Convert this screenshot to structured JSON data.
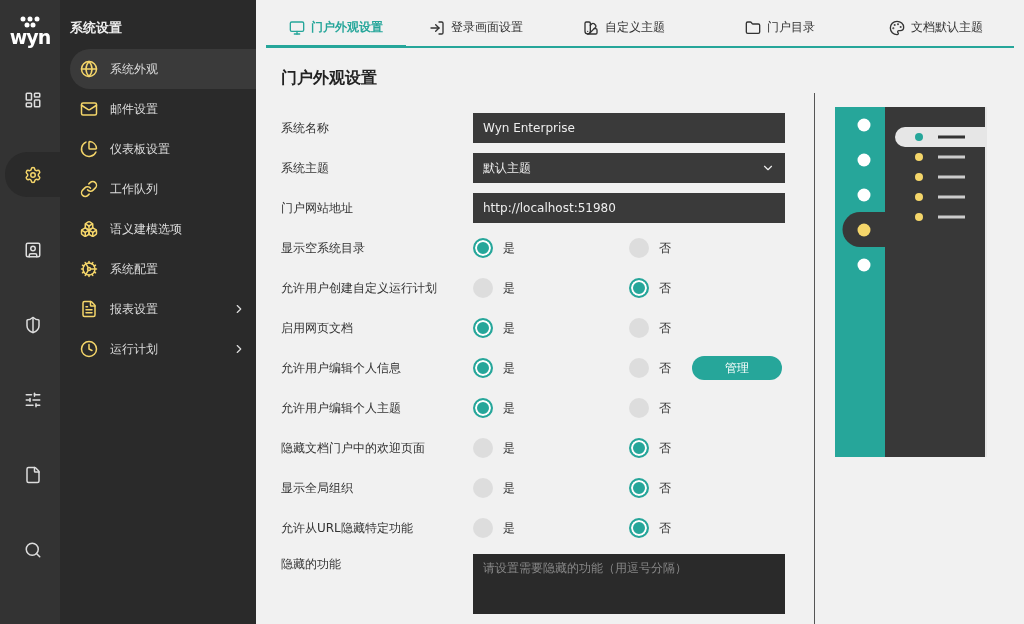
{
  "logo": {
    "text": "wyn"
  },
  "rail": {
    "items": [
      {
        "selected": false
      },
      {
        "selected": true
      },
      {
        "selected": false
      },
      {
        "selected": false
      },
      {
        "selected": false
      },
      {
        "selected": false
      },
      {
        "selected": false
      }
    ]
  },
  "sidebar": {
    "title": "系统设置",
    "items": [
      {
        "label": "系统外观",
        "selected": true,
        "has_children": false
      },
      {
        "label": "邮件设置",
        "selected": false,
        "has_children": false
      },
      {
        "label": "仪表板设置",
        "selected": false,
        "has_children": false
      },
      {
        "label": "工作队列",
        "selected": false,
        "has_children": false
      },
      {
        "label": "语义建模选项",
        "selected": false,
        "has_children": false
      },
      {
        "label": "系统配置",
        "selected": false,
        "has_children": false
      },
      {
        "label": "报表设置",
        "selected": false,
        "has_children": true
      },
      {
        "label": "运行计划",
        "selected": false,
        "has_children": true
      }
    ]
  },
  "tabs": [
    {
      "label": "门户外观设置",
      "selected": true
    },
    {
      "label": "登录画面设置",
      "selected": false
    },
    {
      "label": "自定义主题",
      "selected": false
    },
    {
      "label": "门户目录",
      "selected": false
    },
    {
      "label": "文档默认主题",
      "selected": false
    }
  ],
  "heading": "门户外观设置",
  "form": [
    {
      "kind": "text",
      "label": "系统名称",
      "value": "Wyn Enterprise"
    },
    {
      "kind": "select",
      "label": "系统主题",
      "value": "默认主题"
    },
    {
      "kind": "text",
      "label": "门户网站地址",
      "value": "http://localhost:51980"
    },
    {
      "kind": "radio",
      "label": "显示空系统目录",
      "options": [
        {
          "label": "是",
          "selected": true
        },
        {
          "label": "否",
          "selected": false
        }
      ]
    },
    {
      "kind": "radio",
      "label": "允许用户创建自定义运行计划",
      "options": [
        {
          "label": "是",
          "selected": false
        },
        {
          "label": "否",
          "selected": true
        }
      ]
    },
    {
      "kind": "radio",
      "label": "启用网页文档",
      "options": [
        {
          "label": "是",
          "selected": true
        },
        {
          "label": "否",
          "selected": false
        }
      ]
    },
    {
      "kind": "radio",
      "label": "允许用户编辑个人信息",
      "options": [
        {
          "label": "是",
          "selected": true
        },
        {
          "label": "否",
          "selected": false
        }
      ],
      "button": "管理"
    },
    {
      "kind": "radio",
      "label": "允许用户编辑个人主题",
      "options": [
        {
          "label": "是",
          "selected": true
        },
        {
          "label": "否",
          "selected": false
        }
      ]
    },
    {
      "kind": "radio",
      "label": "隐藏文档门户中的欢迎页面",
      "options": [
        {
          "label": "是",
          "selected": false
        },
        {
          "label": "否",
          "selected": true
        }
      ]
    },
    {
      "kind": "radio",
      "label": "显示全局组织",
      "options": [
        {
          "label": "是",
          "selected": false
        },
        {
          "label": "否",
          "selected": true
        }
      ]
    },
    {
      "kind": "radio",
      "label": "允许从URL隐藏特定功能",
      "options": [
        {
          "label": "是",
          "selected": false
        },
        {
          "label": "否",
          "selected": true
        }
      ]
    },
    {
      "kind": "textarea",
      "label": "隐藏的功能",
      "placeholder": "请设置需要隐藏的功能（用逗号分隔）"
    }
  ]
}
